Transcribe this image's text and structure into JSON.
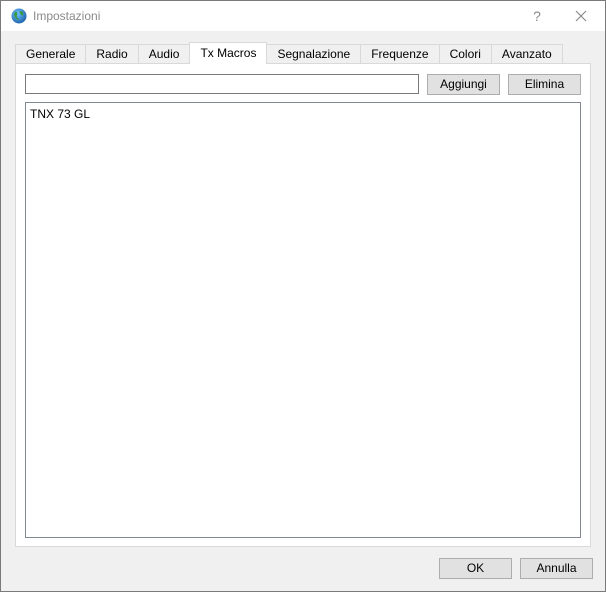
{
  "window": {
    "title": "Impostazioni",
    "help_glyph": "?",
    "close_glyph": "✕"
  },
  "tabs": [
    {
      "label": "Generale",
      "active": false
    },
    {
      "label": "Radio",
      "active": false
    },
    {
      "label": "Audio",
      "active": false
    },
    {
      "label": "Tx Macros",
      "active": true
    },
    {
      "label": "Segnalazione",
      "active": false
    },
    {
      "label": "Frequenze",
      "active": false
    },
    {
      "label": "Colori",
      "active": false
    },
    {
      "label": "Avanzato",
      "active": false
    }
  ],
  "macros": {
    "input_value": "",
    "add_label": "Aggiungi",
    "delete_label": "Elimina",
    "items": [
      "TNX 73 GL"
    ]
  },
  "footer": {
    "ok_label": "OK",
    "cancel_label": "Annulla"
  },
  "colors": {
    "title_text": "#8a8a8a",
    "button_face": "#e1e1e1",
    "button_border": "#adadad"
  }
}
